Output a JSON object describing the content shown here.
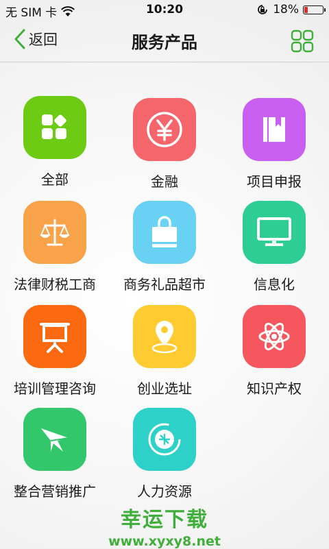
{
  "status_bar": {
    "carrier": "无 SIM 卡",
    "time": "10:20",
    "battery": "18%",
    "battery_level": 0.18
  },
  "nav": {
    "back_label": "返回",
    "title": "服务产品"
  },
  "tiles": [
    {
      "label": "全部",
      "color": "#6ccb12",
      "icon": "apps-icon"
    },
    {
      "label": "金融",
      "color": "#f4656c",
      "icon": "yen-icon"
    },
    {
      "label": "项目申报",
      "color": "#c85ff0",
      "icon": "book-icon"
    },
    {
      "label": "法律财税工商",
      "color": "#f8a24a",
      "icon": "scales-icon"
    },
    {
      "label": "商务礼品超市",
      "color": "#69d1f3",
      "icon": "shopping-bag-icon"
    },
    {
      "label": "信息化",
      "color": "#2dcd93",
      "icon": "monitor-icon"
    },
    {
      "label": "培训管理咨询",
      "color": "#fb6a11",
      "icon": "presentation-board-icon"
    },
    {
      "label": "创业选址",
      "color": "#fecb31",
      "icon": "location-pin-icon"
    },
    {
      "label": "知识产权",
      "color": "#f6575f",
      "icon": "atom-icon"
    },
    {
      "label": "整合营销推广",
      "color": "#31c76a",
      "icon": "paper-plane-icon"
    },
    {
      "label": "人力资源",
      "color": "#2ed1c8",
      "icon": "recruit-icon"
    }
  ],
  "watermark": {
    "title": "幸运下载",
    "url": "www.xyxy8.net"
  }
}
